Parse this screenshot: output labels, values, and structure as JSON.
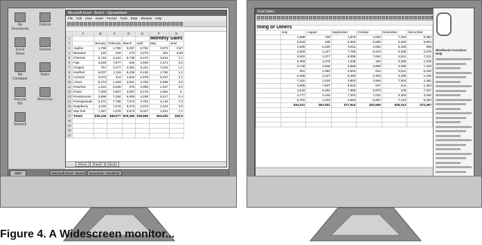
{
  "caption": "Figure 4. A Widescreen monitor...",
  "left_monitor": {
    "window_title": "Microsoft Excel - Book1 - Spreadsheet",
    "window_title_2": "",
    "menu": [
      "File",
      "Edit",
      "View",
      "Insert",
      "Format",
      "Tools",
      "Data",
      "Window",
      "Help"
    ],
    "sheet_title": "Monthly Sales",
    "col_headers": [
      "",
      "A",
      "B",
      "C",
      "D",
      "E",
      "F",
      "G"
    ],
    "months": [
      "January",
      "February",
      "March",
      "April",
      "May",
      "June"
    ],
    "rows": [
      {
        "label": "Apples",
        "v": [
          "1,786",
          "4,765",
          "3,037",
          "6,751",
          "3,073",
          "2,67"
        ]
      },
      {
        "label": "Bananas",
        "v": [
          "120",
          "203",
          "172",
          "3,275",
          "301",
          "3,08"
        ]
      },
      {
        "label": "Cherries",
        "v": [
          "5,723",
          "5,424",
          "5,738",
          "9,472",
          "3,644",
          "7,1"
        ]
      },
      {
        "label": "Figs",
        "v": [
          "3,020",
          "7,877",
          "630",
          "3,409",
          "1,371",
          "2,0"
        ]
      },
      {
        "label": "Grapes",
        "v": [
          "757",
          "3,177",
          "4,391",
          "6,211",
          "7,219",
          "1,1"
        ]
      },
      {
        "label": "Kiwifruit",
        "v": [
          "6,007",
          "1,118",
          "6,235",
          "6,136",
          "2,785",
          "1,2"
        ]
      },
      {
        "label": "Lemons",
        "v": [
          "3,073",
          "414",
          "1,940",
          "1,878",
          "5,047",
          "2,1"
        ]
      },
      {
        "label": "Limes",
        "v": [
          "5,474",
          "1,463",
          "4,061",
          "4,793",
          "6,358",
          "4,0"
        ]
      },
      {
        "label": "Peaches",
        "v": [
          "1,221",
          "6,039",
          "370",
          "3,009",
          "1,227",
          "3,0"
        ]
      },
      {
        "label": "Pears",
        "v": [
          "7,004",
          "1,807",
          "4,087",
          "6,179",
          "2,061",
          "6,"
        ]
      },
      {
        "label": "Persimmons",
        "v": [
          "3,896",
          "7,264",
          "6,609",
          "4,189",
          "6,217",
          "2,4"
        ]
      },
      {
        "label": "Pomegranate",
        "v": [
          "5,272",
          "7,799",
          "7,074",
          "4,754",
          "3,146",
          "7,0"
        ]
      },
      {
        "label": "Raspberry",
        "v": [
          "4,516",
          "7,270",
          "3,273",
          "2,079",
          "2,104",
          "4,0"
        ]
      },
      {
        "label": "Star fruit",
        "v": [
          "7,457",
          "1,075",
          "3,873",
          "5,027",
          "1,621",
          "7,1"
        ]
      }
    ],
    "total": {
      "label": "Totals",
      "v": [
        "$35,249",
        "$48,677",
        "$25,286",
        "$38,968",
        "$26,452",
        "$40,9"
      ]
    },
    "sheet_tabs": [
      "Sheet1",
      "Sheet2",
      "Sheet3"
    ],
    "desktop_icons": [
      "My Documents",
      "Excel Sheet",
      "My Computer",
      "Recycle Bin",
      "Network",
      "Outlook",
      "Internet",
      "Notes",
      "Word Doc"
    ],
    "start_label": "start",
    "taskbar_items": [
      "Microsoft Excel - Book1",
      "Document - WordPad"
    ]
  },
  "right_monitor": {
    "window_title": "Fruit Sales",
    "sheet_title": "thing or Others",
    "months": [
      "July",
      "August",
      "September",
      "October",
      "November",
      "December"
    ],
    "rows": [
      [
        "4,688",
        "729",
        "1,876",
        "2,053",
        "7,402",
        "6,384"
      ],
      [
        "6,516",
        "348",
        "6,002",
        "6,605",
        "5,204",
        "6,804"
      ],
      [
        "2,605",
        "5,226",
        "6,811",
        "4,062",
        "5,220",
        "368"
      ],
      [
        "2,940",
        "1,227",
        "7,796",
        "9,443",
        "6,205",
        "2,679"
      ],
      [
        "3,002",
        "4,377",
        "6,006",
        "7,052",
        "6,811",
        "7,221"
      ],
      [
        "5,493",
        "4,376",
        "1,638",
        "346",
        "5,356",
        "1,025"
      ],
      [
        "6,736",
        "4,646",
        "3,659",
        "3,908",
        "3,089",
        "7,403"
      ],
      [
        "661",
        "1,592",
        "3,534",
        "612",
        "5,511",
        "6,332"
      ],
      [
        "6,255",
        "2,227",
        "5,284",
        "2,403",
        "2,290",
        "1,100"
      ],
      [
        "7,181",
        "1,616",
        "3,603",
        "3,946",
        "7,004",
        "2,481"
      ],
      [
        "3,605",
        "7,847",
        "6,632",
        "947",
        "611",
        "1,304"
      ],
      [
        "4,516",
        "5,294",
        "7,655",
        "8,970",
        "236",
        "7,347"
      ],
      [
        "4,777",
        "3,440",
        "7,202",
        "7,021",
        "5,302",
        "2,040"
      ],
      [
        "6,781",
        "4,103",
        "4,664",
        "6,287",
        "7,210",
        "5,294"
      ]
    ],
    "total": [
      "$34,021",
      "$52,001",
      "$77,914",
      "$33,555",
      "$45,313",
      "$72,467"
    ],
    "pane_title": "Workbook Functions Help"
  }
}
